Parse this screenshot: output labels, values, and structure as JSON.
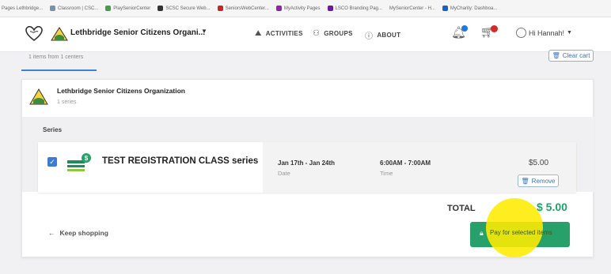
{
  "bookmarks": [
    {
      "label": "Pages Lethbridge...",
      "icon": "",
      "color": ""
    },
    {
      "label": "Classroom | CSC...",
      "icon": "bookmark-icon",
      "color": "#7d8fb1"
    },
    {
      "label": "PlaySeniorCenter",
      "icon": "bookmark-icon",
      "color": "#43a047"
    },
    {
      "label": "SCSC Secure Web...",
      "icon": "bookmark-icon",
      "color": "#333333"
    },
    {
      "label": "SeniorsWebCenter...",
      "icon": "bookmark-icon",
      "color": "#c62828"
    },
    {
      "label": "MyActivity Pages",
      "icon": "bookmark-icon",
      "color": "#8e24aa"
    },
    {
      "label": "LSCO Branding Pag...",
      "icon": "bookmark-icon",
      "color": "#6a1b9a"
    },
    {
      "label": "MySeniorCenter - H...",
      "icon": "",
      "color": ""
    },
    {
      "label": "MyCharity: Dashboa...",
      "icon": "bookmark-icon",
      "color": "#1565c0"
    }
  ],
  "navbar": {
    "org_name": "Lethbridge Senior Citizens Organi...",
    "links": [
      {
        "label": "ACTIVITIES",
        "icon": "activities-icon"
      },
      {
        "label": "GROUPS",
        "icon": "groups-icon"
      },
      {
        "label": "ABOUT",
        "icon": "about-icon"
      }
    ],
    "user_greeting": "Hi Hannah!"
  },
  "summary": "1 items from 1 centers",
  "clear_cart_label": "Clear cart",
  "org_card": {
    "title": "Lethbridge Senior Citizens Organization",
    "subtitle": "1 series",
    "series_heading": "Series",
    "item": {
      "title": "TEST REGISTRATION CLASS series",
      "date_value": "Jan 17th - Jan 24th",
      "date_label": "Date",
      "time_value": "6:00AM - 7:00AM",
      "time_label": "Time",
      "price": "$5.00",
      "remove_label": "Remove",
      "icon_badge": "$"
    }
  },
  "total_label": "TOTAL",
  "total_value": "$ 5.00",
  "keep_shopping_label": "Keep shopping",
  "pay_label": "Pay for selected items",
  "colors": {
    "accent": "#3b82d4",
    "pay": "#27a069",
    "total": "#22a06b",
    "highlight": "#ffec00"
  }
}
